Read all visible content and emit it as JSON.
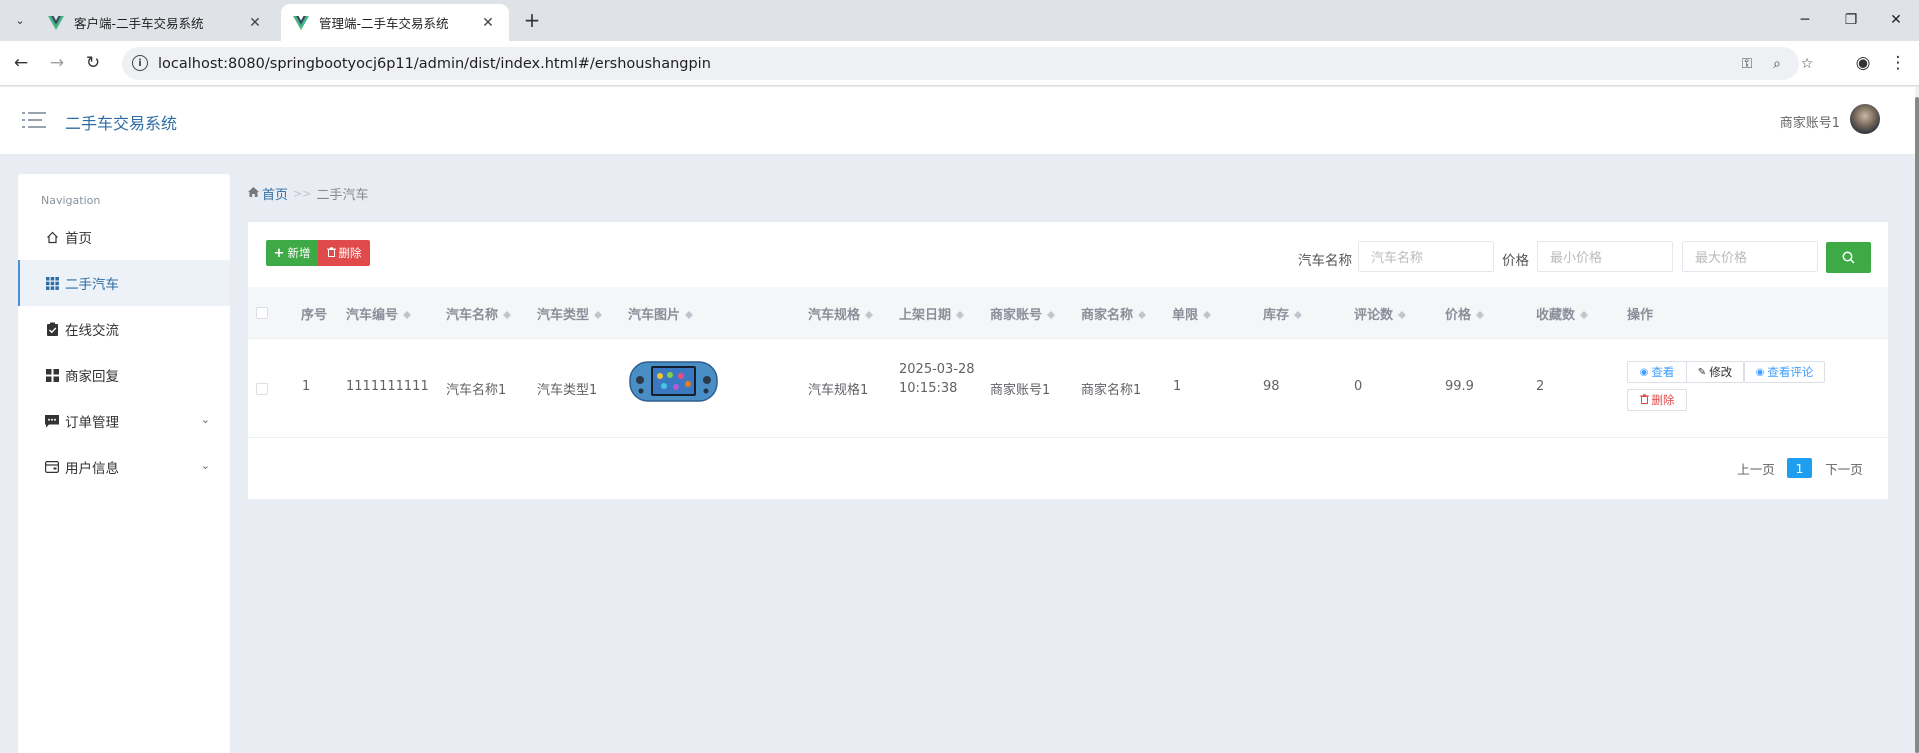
{
  "browser": {
    "tabs": [
      {
        "title": "客户端-二手车交易系统",
        "active": false
      },
      {
        "title": "管理端-二手车交易系统",
        "active": true
      }
    ],
    "url": "localhost:8080/springbootyocj6p11/admin/dist/index.html#/ershoushangpin"
  },
  "header": {
    "app_title": "二手车交易系统",
    "user_name": "商家账号1"
  },
  "sidebar": {
    "heading": "Navigation",
    "items": [
      {
        "label": "首页",
        "icon": "home-icon",
        "active": false,
        "expandable": false
      },
      {
        "label": "二手汽车",
        "icon": "grid-icon",
        "active": true,
        "expandable": false
      },
      {
        "label": "在线交流",
        "icon": "clipboard-check-icon",
        "active": false,
        "expandable": false
      },
      {
        "label": "商家回复",
        "icon": "apps-icon",
        "active": false,
        "expandable": false
      },
      {
        "label": "订单管理",
        "icon": "message-icon",
        "active": false,
        "expandable": true
      },
      {
        "label": "用户信息",
        "icon": "wallet-icon",
        "active": false,
        "expandable": true
      }
    ]
  },
  "breadcrumb": {
    "home": "首页",
    "separator": ">>",
    "current": "二手汽车"
  },
  "toolbar": {
    "add_label": "新增",
    "delete_label": "删除"
  },
  "filters": {
    "name_label": "汽车名称",
    "name_placeholder": "汽车名称",
    "price_label": "价格",
    "min_price_placeholder": "最小价格",
    "max_price_placeholder": "最大价格"
  },
  "table": {
    "columns": [
      "序号",
      "汽车编号",
      "汽车名称",
      "汽车类型",
      "汽车图片",
      "汽车规格",
      "上架日期",
      "商家账号",
      "商家名称",
      "单限",
      "库存",
      "评论数",
      "价格",
      "收藏数",
      "操作"
    ],
    "rows": [
      {
        "index": "1",
        "code": "1111111111",
        "name": "汽车名称1",
        "type": "汽车类型1",
        "spec": "汽车规格1",
        "date": "2025-03-28",
        "time": "10:15:38",
        "merchant_account": "商家账号1",
        "merchant_name": "商家名称1",
        "limit": "1",
        "stock": "98",
        "comments": "0",
        "price": "99.9",
        "favorites": "2"
      }
    ],
    "actions": {
      "view": "查看",
      "edit": "修改",
      "view_reviews": "查看评论",
      "delete": "删除"
    }
  },
  "pagination": {
    "prev": "上一页",
    "current_page": "1",
    "next": "下一页"
  },
  "colors": {
    "primary_blue": "#2d6da3",
    "success_green": "#3eaa45",
    "danger_red": "#e04a4a",
    "page_active": "#1e9ef0"
  }
}
